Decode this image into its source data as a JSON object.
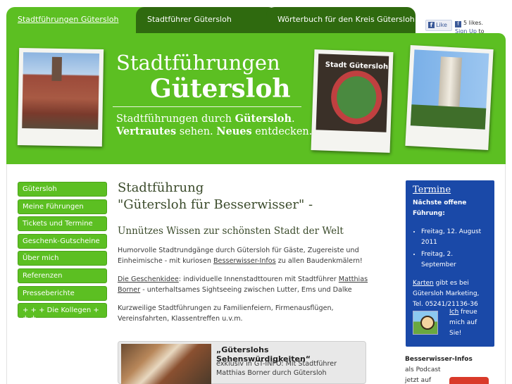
{
  "tabs": [
    {
      "label": "Stadtführungen Gütersloh"
    },
    {
      "label": "Stadtführer Gütersloh"
    },
    {
      "label": "Wörterbuch für den Kreis Gütersloh"
    }
  ],
  "facebook": {
    "like_label": "Like",
    "likes_text": "5 likes.",
    "signup_text": "Sign Up",
    "signup_tail": "to see what your friends"
  },
  "header": {
    "title_line1": "Stadtführungen",
    "title_line2": "Gütersloh",
    "sub1_pre": "Stadtführungen durch ",
    "sub1_bold": "Gütersloh",
    "sub1_post": ".",
    "sub2_bold1": "Vertrautes",
    "sub2_mid": " sehen. ",
    "sub2_bold2": "Neues",
    "sub2_post": " entdecken.",
    "sign_label": "Stadt Gütersloh"
  },
  "nav": {
    "items": [
      "Gütersloh",
      "Meine Führungen",
      "Tickets und Termine",
      "Geschenk-Gutscheine",
      "Über mich",
      "Referenzen",
      "Presseberichte",
      "+ + + Die Kollegen + + +"
    ]
  },
  "main": {
    "heading_line1": "Stadtführung",
    "heading_line2": "\"Gütersloh für Besserwisser\" -",
    "subheading": "Unnützes Wissen zur schönsten Stadt der Welt",
    "p1_pre": "Humorvolle Stadtrundgänge durch Gütersloh für Gäste, Zugereiste und Einheimische - mit kuriosen ",
    "p1_link": "Besserwisser-Infos",
    "p1_post": " zu allen Baudenkmälern!",
    "p2_link1": "Die Geschenkidee",
    "p2_mid": ": individuelle Innenstadttouren mit Stadtführer ",
    "p2_link2": "Matthias Borner",
    "p2_post": " - unterhaltsames Sightseeing zwischen Lutter, Ems und Dalke",
    "p3": "Kurzweilige Stadtführungen zu Familienfeiern, Firmenausflügen, Vereinsfahrten, Klassentreffen u.v.m."
  },
  "teaser": {
    "title": "„Güterslohs Sehenswürdigkeiten“",
    "text": "exklusiv in GT-INFO: Mit Stadtführer Matthias Borner durch Gütersloh"
  },
  "sidebar": {
    "title": "Termine",
    "subtitle": "Nächste offene Führung:",
    "dates": [
      "Freitag, 12. August 2011",
      "Freitag, 2. September"
    ],
    "karten_link": "Karten",
    "karten_text": " gibt es bei Gütersloh Marketing, Tel. 05241/21136-36",
    "ich_link": "Ich",
    "ich_text": " freue mich auf Sie!"
  },
  "podcast": {
    "title": "Besserwisser-Infos",
    "line2": "als Podcast",
    "line3": "jetzt auf"
  }
}
